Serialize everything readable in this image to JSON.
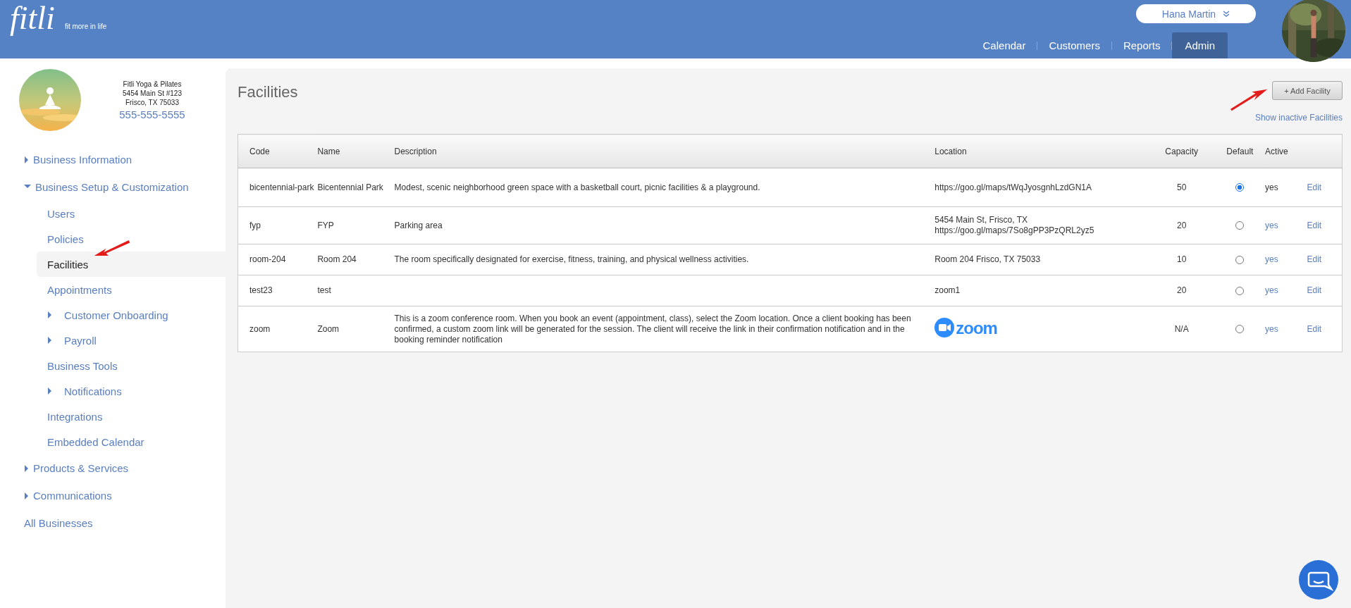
{
  "header": {
    "logo": "fitli",
    "tagline": "fit more in life",
    "user": "Hana Martin",
    "nav": [
      {
        "label": "Calendar",
        "selected": false
      },
      {
        "label": "Customers",
        "selected": false
      },
      {
        "label": "Reports",
        "selected": false
      },
      {
        "label": "Admin",
        "selected": true
      }
    ]
  },
  "business": {
    "name": "Fitli Yoga & Pilates",
    "address_1": "5454 Main St #123",
    "address_2": "Frisco, TX 75033",
    "phone": "555-555-5555"
  },
  "sidebar": {
    "items": [
      {
        "label": "Business Information",
        "expanded": false,
        "selected": false
      },
      {
        "label": "Business Setup & Customization",
        "expanded": true,
        "selected": false,
        "children": [
          {
            "label": "Users",
            "selected": false
          },
          {
            "label": "Policies",
            "selected": false
          },
          {
            "label": "Facilities",
            "selected": true
          },
          {
            "label": "Appointments",
            "selected": false
          },
          {
            "label": "Customer Onboarding",
            "expanded": false,
            "selected": false
          },
          {
            "label": "Payroll",
            "expanded": false,
            "selected": false
          },
          {
            "label": "Business Tools",
            "selected": false
          },
          {
            "label": "Notifications",
            "expanded": false,
            "selected": false
          },
          {
            "label": "Integrations",
            "selected": false
          },
          {
            "label": "Embedded Calendar",
            "selected": false
          }
        ]
      },
      {
        "label": "Products & Services",
        "expanded": false,
        "selected": false
      },
      {
        "label": "Communications",
        "expanded": false,
        "selected": false
      },
      {
        "label": "All Businesses",
        "selected": false
      }
    ]
  },
  "page": {
    "title": "Facilities",
    "add_button": "+ Add Facility",
    "inactive_link": "Show inactive Facilities"
  },
  "table": {
    "columns": [
      "Code",
      "Name",
      "Description",
      "Location",
      "Capacity",
      "Default",
      "Active"
    ],
    "rows": [
      {
        "code": "bicentennial-park",
        "name": "Bicentennial Park",
        "description": "Modest, scenic neighborhood green space with a basketball court, picnic facilities & a playground.",
        "location": [
          "https://goo.gl/maps/tWqJyosgnhLzdGN1A"
        ],
        "capacity": "50",
        "default": true,
        "active": "yes",
        "active_link": false,
        "edit": "Edit"
      },
      {
        "code": "fyp",
        "name": "FYP",
        "description": "Parking area",
        "location": [
          "5454 Main St, Frisco, TX",
          "https://goo.gl/maps/7So8gPP3PzQRL2yz5"
        ],
        "capacity": "20",
        "default": false,
        "active": "yes",
        "active_link": true,
        "edit": "Edit"
      },
      {
        "code": "room-204",
        "name": "Room 204",
        "description": "The room specifically designated for exercise, fitness, training, and physical wellness activities.",
        "location": [
          "Room 204 Frisco, TX 75033"
        ],
        "capacity": "10",
        "default": false,
        "active": "yes",
        "active_link": true,
        "edit": "Edit"
      },
      {
        "code": "test23",
        "name": "test",
        "location": [
          "zoom1"
        ],
        "capacity": "20",
        "default": false,
        "active": "yes",
        "active_link": true,
        "edit": "Edit"
      },
      {
        "code": "zoom",
        "name": "Zoom",
        "description": "This is a zoom conference room. When you book an event (appointment, class), select the Zoom location. Once a client booking has been confirmed, a custom zoom link will be generated for the session. The client will receive the link in their confirmation notification and in the booking reminder notification",
        "location_logo": "zoom",
        "capacity": "N/A",
        "default": false,
        "active": "yes",
        "active_link": true,
        "edit": "Edit"
      }
    ]
  }
}
